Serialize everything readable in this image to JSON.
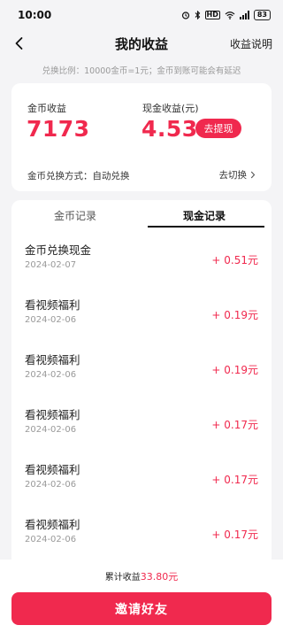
{
  "status_bar": {
    "time": "10:00",
    "network_badge": "HD",
    "battery": "83"
  },
  "nav": {
    "title": "我的收益",
    "right_link": "收益说明"
  },
  "notice": "兑换比例：10000金币=1元；金币到账可能会有延迟",
  "summary": {
    "coin_label": "金币收益",
    "coin_value": "7173",
    "cash_label": "现金收益(元)",
    "cash_value": "4.53",
    "withdraw_label": "去提现",
    "exchange_mode": "金币兑换方式：自动兑换",
    "switch_label": "去切换"
  },
  "tabs": [
    {
      "label": "金币记录",
      "active": false
    },
    {
      "label": "现金记录",
      "active": true
    }
  ],
  "records": [
    {
      "title": "金币兑换现金",
      "date": "2024-02-07",
      "amount": "+ 0.51元"
    },
    {
      "title": "看视频福利",
      "date": "2024-02-06",
      "amount": "+ 0.19元"
    },
    {
      "title": "看视频福利",
      "date": "2024-02-06",
      "amount": "+ 0.19元"
    },
    {
      "title": "看视频福利",
      "date": "2024-02-06",
      "amount": "+ 0.17元"
    },
    {
      "title": "看视频福利",
      "date": "2024-02-06",
      "amount": "+ 0.17元"
    },
    {
      "title": "看视频福利",
      "date": "2024-02-06",
      "amount": "+ 0.17元"
    }
  ],
  "footer": {
    "total_label": "累计收益",
    "total_value": "33.80元",
    "invite_label": "邀请好友"
  },
  "colors": {
    "accent": "#f0294e",
    "background": "#f4f4f6"
  },
  "icons": {
    "back": "back-arrow-icon",
    "switch": "chevron-right-icon"
  }
}
